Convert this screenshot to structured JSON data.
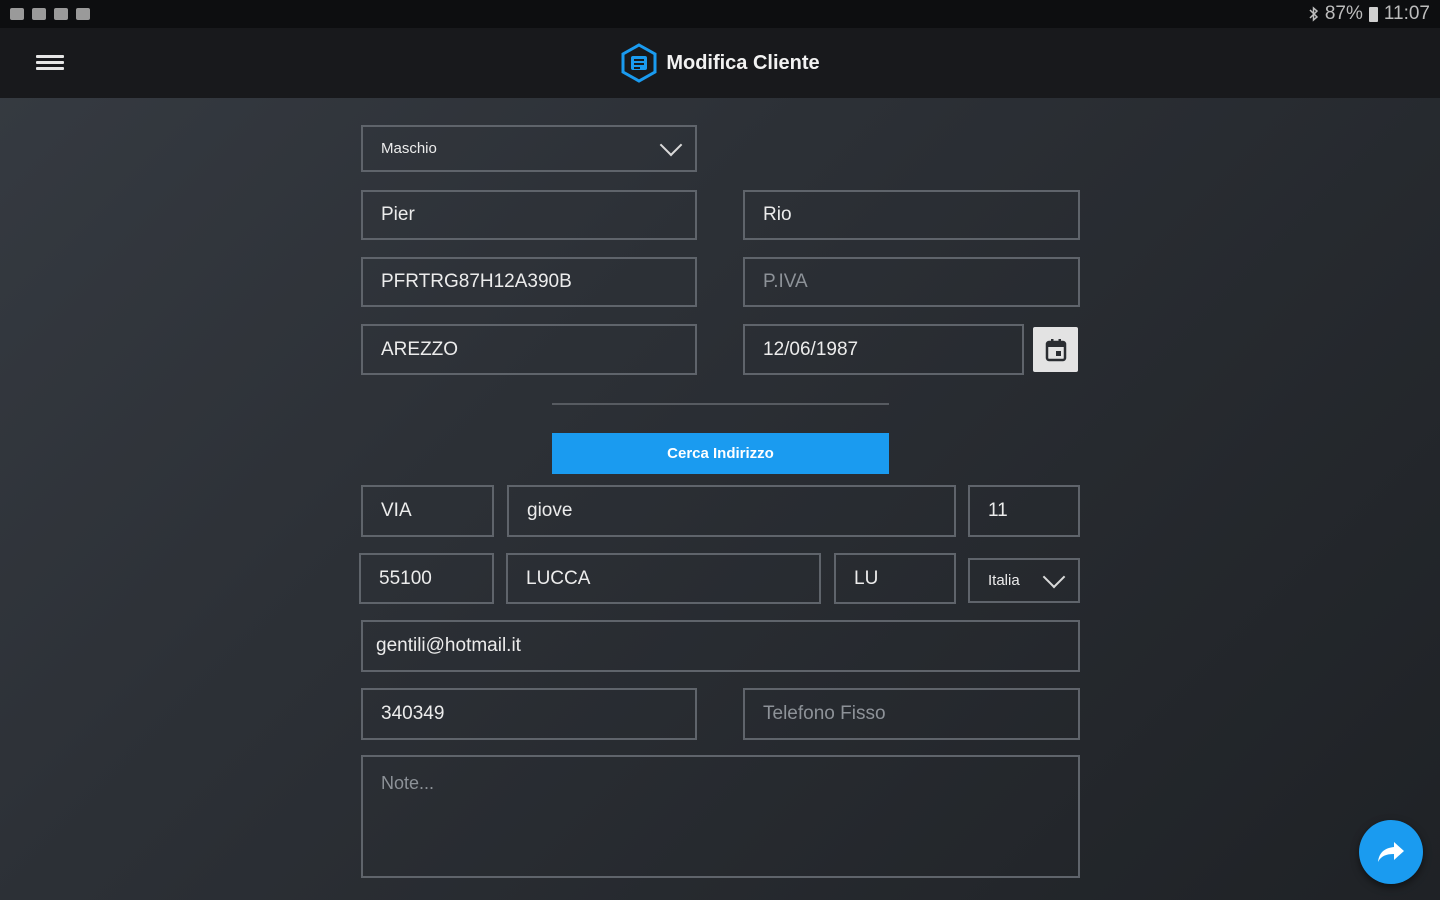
{
  "status_bar": {
    "battery": "87%",
    "time": "11:07"
  },
  "app_bar": {
    "title": "Modifica Cliente"
  },
  "form": {
    "gender": "Maschio",
    "first_name": "Pier",
    "last_name": "Rio",
    "fiscal_code": "PFRTRG87H12A390B",
    "vat_placeholder": "P.IVA",
    "birth_place": "AREZZO",
    "birth_date": "12/06/1987",
    "search_address_label": "Cerca Indirizzo",
    "street_type": "VIA",
    "street_name": "giove",
    "street_number": "11",
    "zip": "55100",
    "city": "LUCCA",
    "province": "LU",
    "country": "Italia",
    "email": "gentili@hotmail.it",
    "mobile": "340349",
    "landline_placeholder": "Telefono Fisso",
    "notes_placeholder": "Note..."
  },
  "colors": {
    "accent": "#1a9bf0",
    "appbar": "#18191c",
    "field_border": "#5f646b"
  }
}
